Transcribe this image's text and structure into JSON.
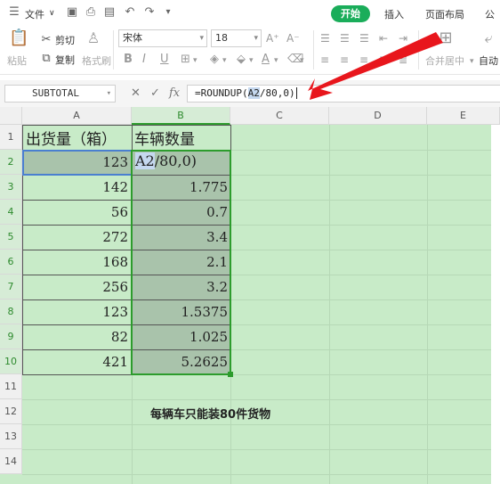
{
  "menubar": {
    "file_label": "文件",
    "tabs": [
      "开始",
      "插入",
      "页面布局",
      "公"
    ]
  },
  "ribbon": {
    "paste_label": "粘贴",
    "cut_label": "剪切",
    "copy_label": "复制",
    "format_painter_label": "格式刷",
    "font_name": "宋体",
    "font_size": "18",
    "merge_label": "合并居中",
    "wrap_label": "自动"
  },
  "formula_bar": {
    "name_box": "SUBTOTAL",
    "fx_label": "fx",
    "formula_prefix": "=ROUNDUP(",
    "formula_ref": "A2",
    "formula_suffix": "/80,0)"
  },
  "grid": {
    "columns": [
      "A",
      "B",
      "C",
      "D",
      "E"
    ],
    "rows": [
      "1",
      "2",
      "3",
      "4",
      "5",
      "6",
      "7",
      "8",
      "9",
      "10",
      "11",
      "12",
      "13",
      "14"
    ],
    "header_a": "出货量（箱）",
    "header_b": "车辆数量",
    "editing_ref": "A2",
    "editing_rest": "/80,0)",
    "a_values": [
      "123",
      "142",
      "56",
      "272",
      "168",
      "256",
      "123",
      "82",
      "421"
    ],
    "b_values": [
      "1.775",
      "0.7",
      "3.4",
      "2.1",
      "3.2",
      "1.5375",
      "1.025",
      "5.2625"
    ],
    "note": "每辆车只能装80件货物"
  },
  "colors": {
    "sheet_bg": "#c8ebc8",
    "selected_fill": "#a9c3ab",
    "accent_green": "#1aad5a",
    "arrow_red": "#e8161c"
  }
}
